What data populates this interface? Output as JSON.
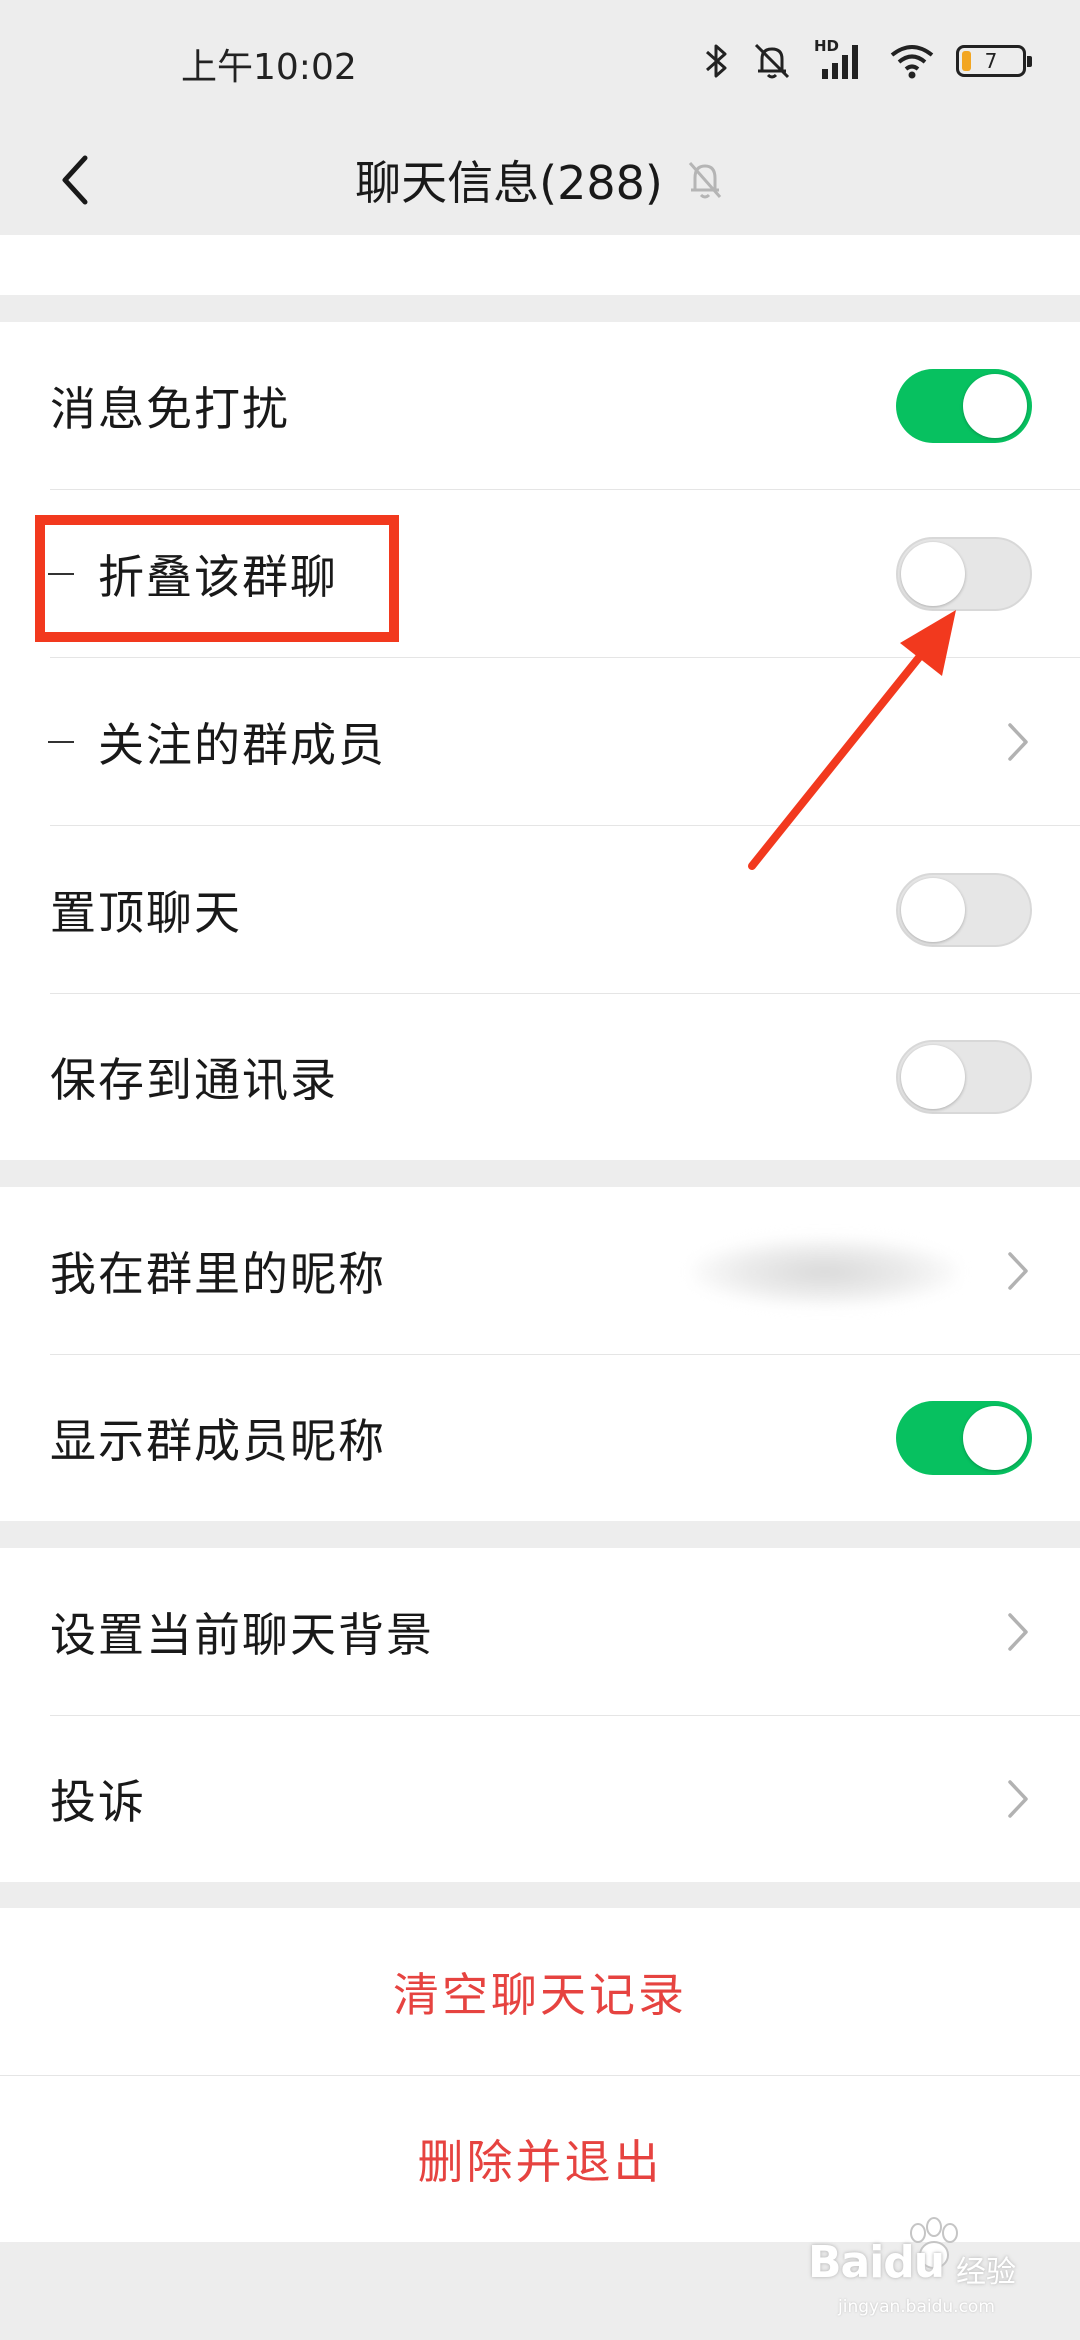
{
  "status_bar": {
    "time": "上午10:02",
    "network_label": "HD",
    "battery_level": "7",
    "icons": [
      "bluetooth-icon",
      "mute-icon",
      "signal-icon",
      "wifi-icon",
      "battery-icon"
    ]
  },
  "nav": {
    "title": "聊天信息(288)",
    "back_icon": "back-arrow-icon",
    "mute_indicator_icon": "muted-bell-icon"
  },
  "section_settings": {
    "rows": [
      {
        "label": "消息免打扰",
        "control": "toggle",
        "on": true
      },
      {
        "label": "折叠该群聊",
        "control": "toggle",
        "on": false
      },
      {
        "label": "关注的群成员",
        "control": "chevron"
      },
      {
        "label": "置顶聊天",
        "control": "toggle",
        "on": false
      },
      {
        "label": "保存到通讯录",
        "control": "toggle",
        "on": false
      }
    ]
  },
  "section_nickname": {
    "rows": [
      {
        "label": "我在群里的昵称",
        "control": "chevron",
        "value": ""
      },
      {
        "label": "显示群成员昵称",
        "control": "toggle",
        "on": true
      }
    ]
  },
  "section_misc": {
    "rows": [
      {
        "label": "设置当前聊天背景",
        "control": "chevron"
      },
      {
        "label": "投诉",
        "control": "chevron"
      }
    ]
  },
  "actions": {
    "clear_history": "清空聊天记录",
    "delete_and_exit": "删除并退出"
  },
  "annotations": {
    "highlight_color": "#f2391e"
  },
  "watermark": {
    "brand": "Baidu",
    "cn": "经验",
    "url": "jingyan.baidu.com"
  },
  "colors": {
    "toggle_on": "#07c160",
    "danger": "#e64340",
    "background": "#ededed"
  }
}
